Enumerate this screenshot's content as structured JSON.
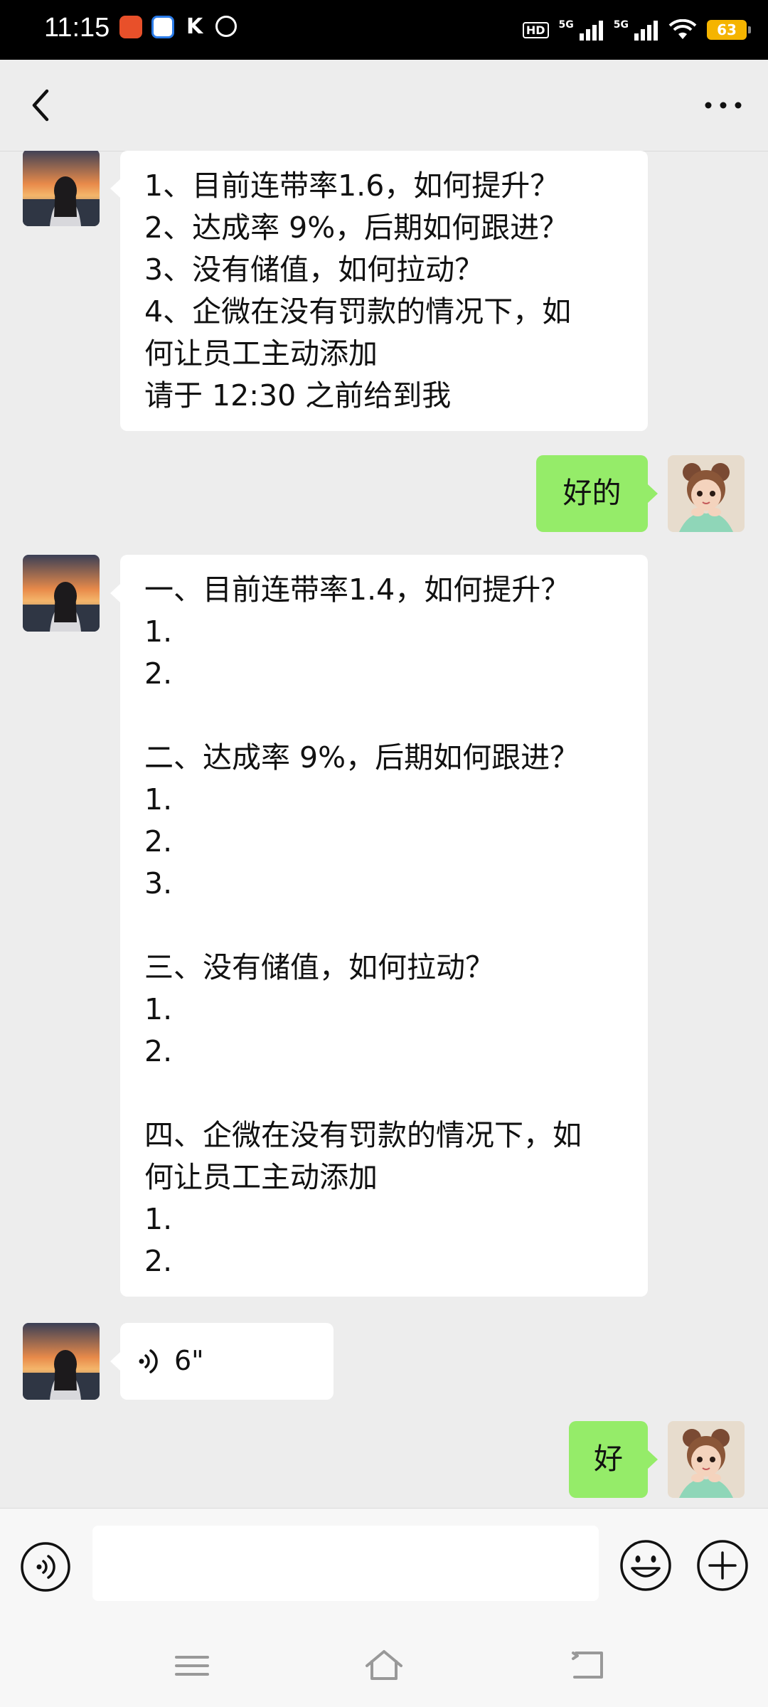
{
  "status_bar": {
    "time": "11:15",
    "network_1": "5G",
    "network_2": "5G",
    "hd_label": "HD",
    "battery": "63"
  },
  "nav": {
    "back_icon": "chevron-left-icon",
    "more_icon": "more-dots-icon"
  },
  "messages": [
    {
      "side": "left",
      "type": "text",
      "lines": [
        "1、目前连带率1.6，如何提升？",
        "2、达成率 9%，后期如何跟进？",
        "3、没有储值，如何拉动？",
        "4、企微在没有罚款的情况下，如",
        "何让员工主动添加",
        "请于 12:30 之前给到我"
      ]
    },
    {
      "side": "right",
      "type": "text",
      "lines": [
        "好的"
      ]
    },
    {
      "side": "left",
      "type": "text",
      "lines": [
        "一、目前连带率1.4，如何提升？",
        "1.",
        "2.",
        "",
        "二、达成率 9%，后期如何跟进？",
        "1.",
        "2.",
        "3.",
        "",
        "三、没有储值，如何拉动？",
        "1.",
        "2.",
        "",
        "四、企微在没有罚款的情况下，如",
        "何让员工主动添加",
        "1.",
        "2."
      ]
    },
    {
      "side": "left",
      "type": "voice",
      "duration": "6\""
    },
    {
      "side": "right",
      "type": "text",
      "lines": [
        "好"
      ]
    }
  ],
  "input_bar": {
    "placeholder": "",
    "voice_icon": "voice-mode-icon",
    "emoji_icon": "emoji-icon",
    "plus_icon": "plus-circle-icon"
  },
  "system_nav": {
    "menu_icon": "menu-icon",
    "home_icon": "home-icon",
    "back_icon": "back-icon"
  },
  "colors": {
    "chat_bg": "#ededed",
    "my_bubble": "#95ec69",
    "their_bubble": "#ffffff",
    "battery": "#f5b400"
  }
}
